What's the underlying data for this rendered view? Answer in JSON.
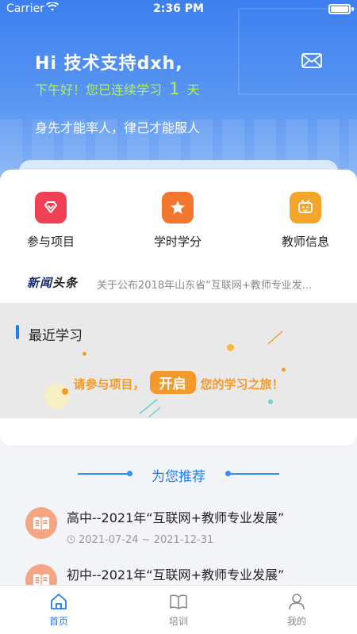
{
  "status_bar": {
    "carrier": "Carrier",
    "time": "2:36 PM"
  },
  "header": {
    "greeting": "Hi 技术支持dxh,",
    "streak_prefix": "下午好！您已连续学习",
    "streak_days": "1",
    "streak_suffix": "天",
    "motto": "身先才能率人，律己才能服人",
    "streak_color": "#b6f04a",
    "mail_icon": "mail-icon"
  },
  "quick_actions": [
    {
      "label": "参与项目",
      "icon": "diamond-icon",
      "color": "#ef4055"
    },
    {
      "label": "学时学分",
      "icon": "star-icon",
      "color": "#f3762f"
    },
    {
      "label": "教师信息",
      "icon": "teacher-icon",
      "color": "#f4a52c"
    }
  ],
  "news": {
    "tag_part1": "新闻",
    "tag_part2": "头条",
    "headline": "关于公布2018年山东省“互联网+教师专业发..."
  },
  "recent": {
    "title": "最近学习",
    "cta_prefix": "请参与项目，",
    "cta_button": "开启",
    "cta_suffix": "您的学习之旅！"
  },
  "recommend": {
    "title": "为您推荐",
    "items": [
      {
        "title": "高中--2021年“互联网+教师专业发展”",
        "date": "2021-07-24 ~ 2021-12-31"
      },
      {
        "title": "初中--2021年“互联网+教师专业发展”",
        "date": ""
      }
    ]
  },
  "tabbar": [
    {
      "label": "首页",
      "icon": "home-icon",
      "active": true
    },
    {
      "label": "培训",
      "icon": "book-icon",
      "active": false
    },
    {
      "label": "我的",
      "icon": "user-icon",
      "active": false
    }
  ],
  "colors": {
    "accent": "#1f7cf2",
    "cta": "#f29b2c"
  }
}
